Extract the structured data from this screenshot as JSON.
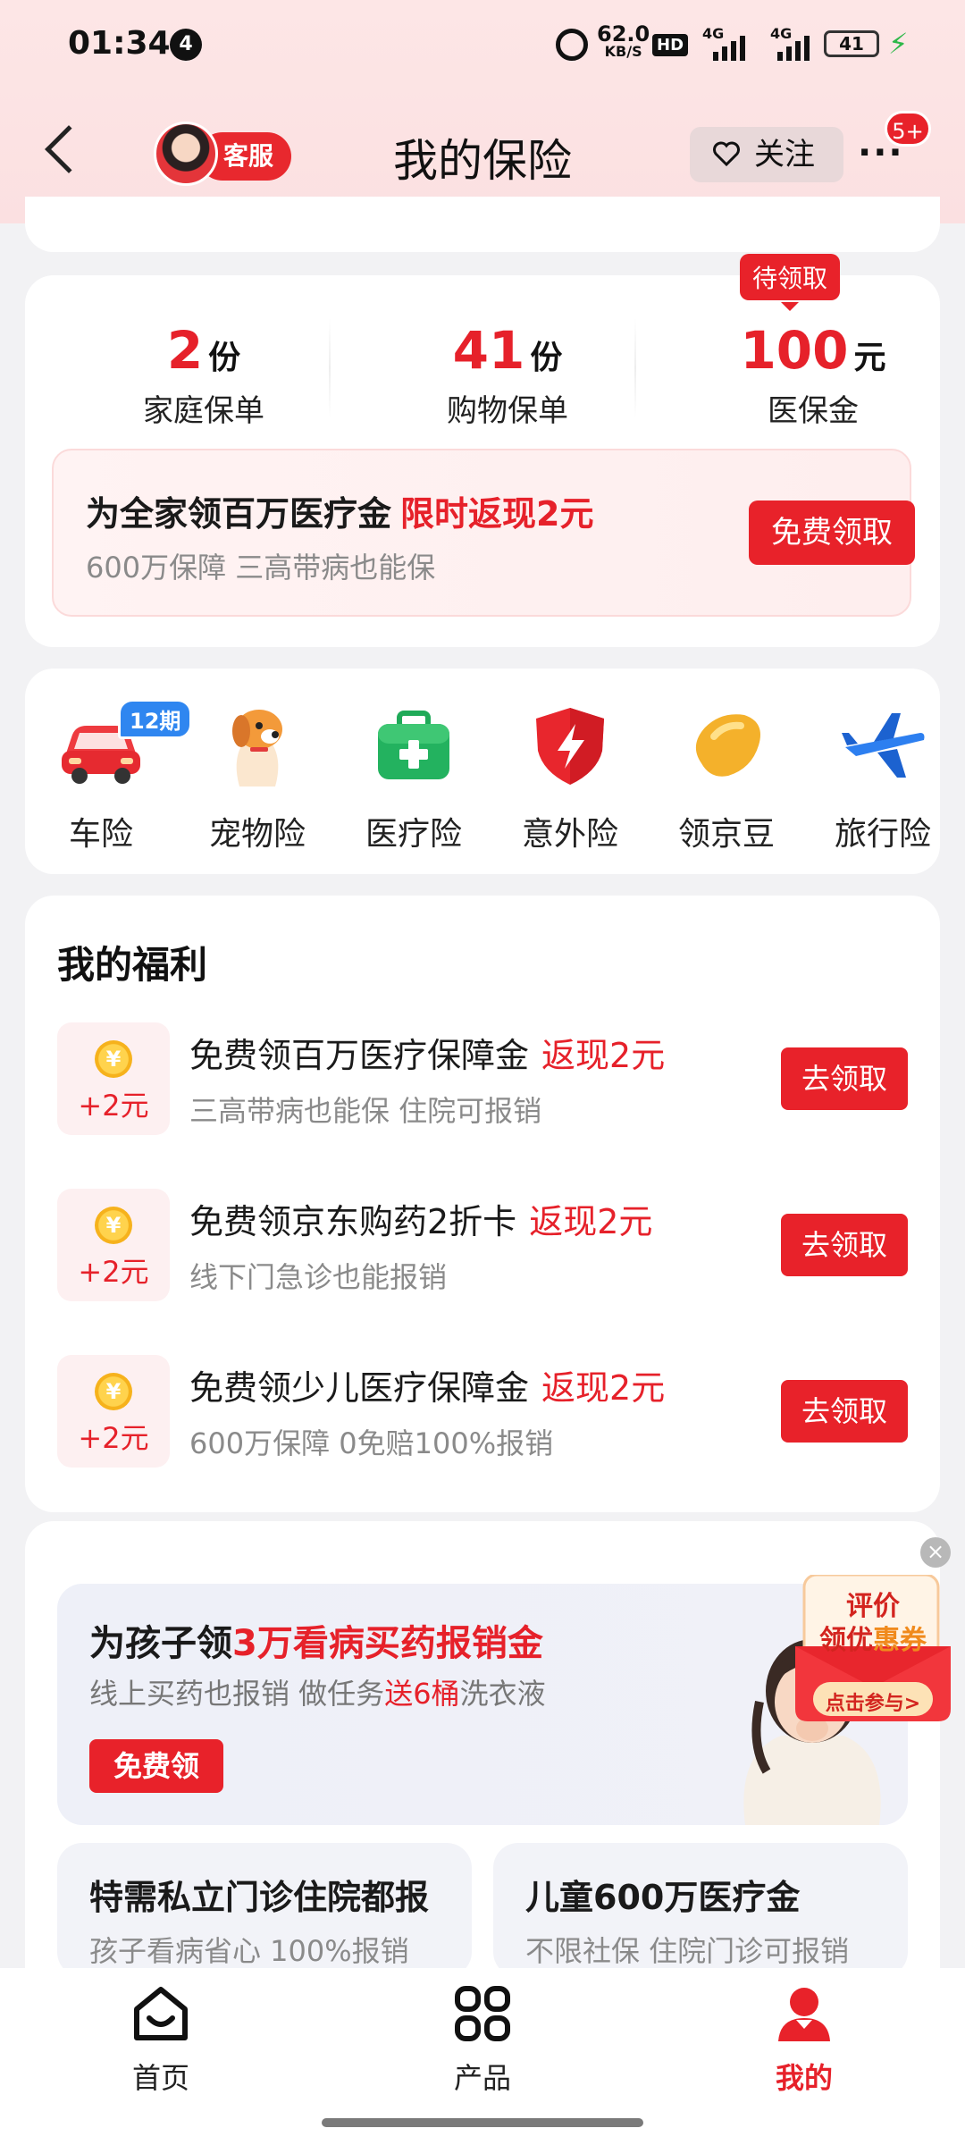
{
  "status_bar": {
    "time": "01:34",
    "notification_count": "4",
    "net_speed": "62.0",
    "net_speed_unit": "KB/S",
    "hd": "HD",
    "sim1": "4G",
    "sim2": "4G",
    "battery": "41"
  },
  "header": {
    "customer_service": "客服",
    "title": "我的保险",
    "follow": "关注",
    "more_badge": "5+"
  },
  "summary": {
    "family": {
      "value": "2",
      "unit": "份",
      "label": "家庭保单"
    },
    "shopping": {
      "value": "41",
      "unit": "份",
      "label": "购物保单"
    },
    "medical": {
      "value": "100",
      "unit": "元",
      "label": "医保金",
      "tag": "待领取"
    },
    "promo": {
      "title": "为全家领百万医疗金",
      "highlight": "限时返现2元",
      "subtitle": "600万保障 三高带病也能保",
      "button": "免费领取"
    }
  },
  "products": [
    {
      "label": "车险",
      "icon": "car-icon",
      "tag": "12期"
    },
    {
      "label": "宠物险",
      "icon": "pet-dog-icon"
    },
    {
      "label": "医疗险",
      "icon": "medical-kit-icon"
    },
    {
      "label": "意外险",
      "icon": "shield-bolt-icon"
    },
    {
      "label": "领京豆",
      "icon": "bean-icon"
    },
    {
      "label": "旅行险",
      "icon": "airplane-icon"
    }
  ],
  "benefits": {
    "title": "我的福利",
    "items": [
      {
        "amount": "+2元",
        "title": "免费领百万医疗保障金",
        "cashback": "返现2元",
        "subtitle": "三高带病也能保 住院可报销",
        "button": "去领取"
      },
      {
        "amount": "+2元",
        "title": "免费领京东购药2折卡",
        "cashback": "返现2元",
        "subtitle": "线下门急诊也能报销",
        "button": "去领取"
      },
      {
        "amount": "+2元",
        "title": "免费领少儿医疗保障金",
        "cashback": "返现2元",
        "subtitle": "600万保障 0免赔100%报销",
        "button": "去领取"
      }
    ],
    "coin_symbol": "¥"
  },
  "kids": {
    "title_prefix": "为孩子领",
    "title_highlight": "3万看病买药报销金",
    "subtitle_prefix": "线上买药也报销 做任务",
    "subtitle_highlight": "送6桶",
    "subtitle_suffix": "洗衣液",
    "button": "免费领",
    "cards": [
      {
        "title": "特需私立门诊住院都报",
        "subtitle": "孩子看病省心 100%报销"
      },
      {
        "title": "儿童600万医疗金",
        "subtitle": "不限社保 住院门诊可报销"
      }
    ]
  },
  "floating_ad": {
    "line1": "评价",
    "line2_prefix": "领优",
    "line2_highlight": "惠券",
    "cta": "点击参与>"
  },
  "tabbar": [
    {
      "label": "首页",
      "icon": "home-icon",
      "active": false
    },
    {
      "label": "产品",
      "icon": "grid-icon",
      "active": false
    },
    {
      "label": "我的",
      "icon": "user-icon",
      "active": true
    }
  ],
  "colors": {
    "accent": "#e6212a",
    "brand_red": "#e8222a",
    "tag_blue": "#2f86f0"
  }
}
